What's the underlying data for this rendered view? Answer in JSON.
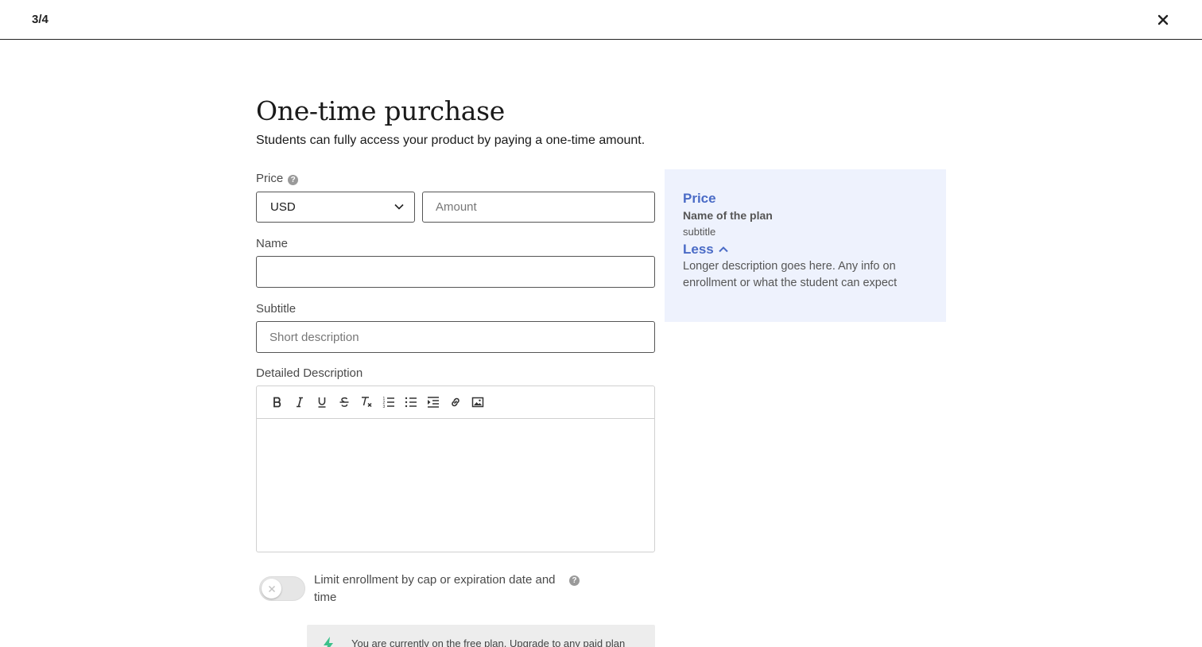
{
  "header": {
    "step": "3/4",
    "close_icon": "close-icon"
  },
  "main": {
    "title": "One-time purchase",
    "subtitle": "Students can fully access your product by paying a one-time amount.",
    "price": {
      "label": "Price",
      "currency": "USD",
      "amount_placeholder": "Amount"
    },
    "name": {
      "label": "Name",
      "value": "",
      "placeholder": ""
    },
    "subtitle_field": {
      "label": "Subtitle",
      "placeholder": "Short description"
    },
    "description": {
      "label": "Detailed Description",
      "toolbar_icons": [
        "bold-icon",
        "italic-icon",
        "underline-icon",
        "strikethrough-icon",
        "clear-format-icon",
        "ordered-list-icon",
        "bullet-list-icon",
        "indent-icon",
        "link-icon",
        "image-icon"
      ]
    },
    "limit": {
      "label": "Limit enrollment by cap or expiration date and time",
      "enabled": false
    },
    "notice": {
      "text": "You are currently on the free plan. Upgrade to any paid plan"
    }
  },
  "preview": {
    "title": "Price",
    "plan_name": "Name of the plan",
    "subtitle": "subtitle",
    "toggle_label": "Less",
    "description": "Longer description goes here. Any info on enrollment or what the student can expect"
  },
  "colors": {
    "accent": "#4a6bc6",
    "preview_bg": "#eef2fd",
    "bolt": "#3cc08a"
  }
}
